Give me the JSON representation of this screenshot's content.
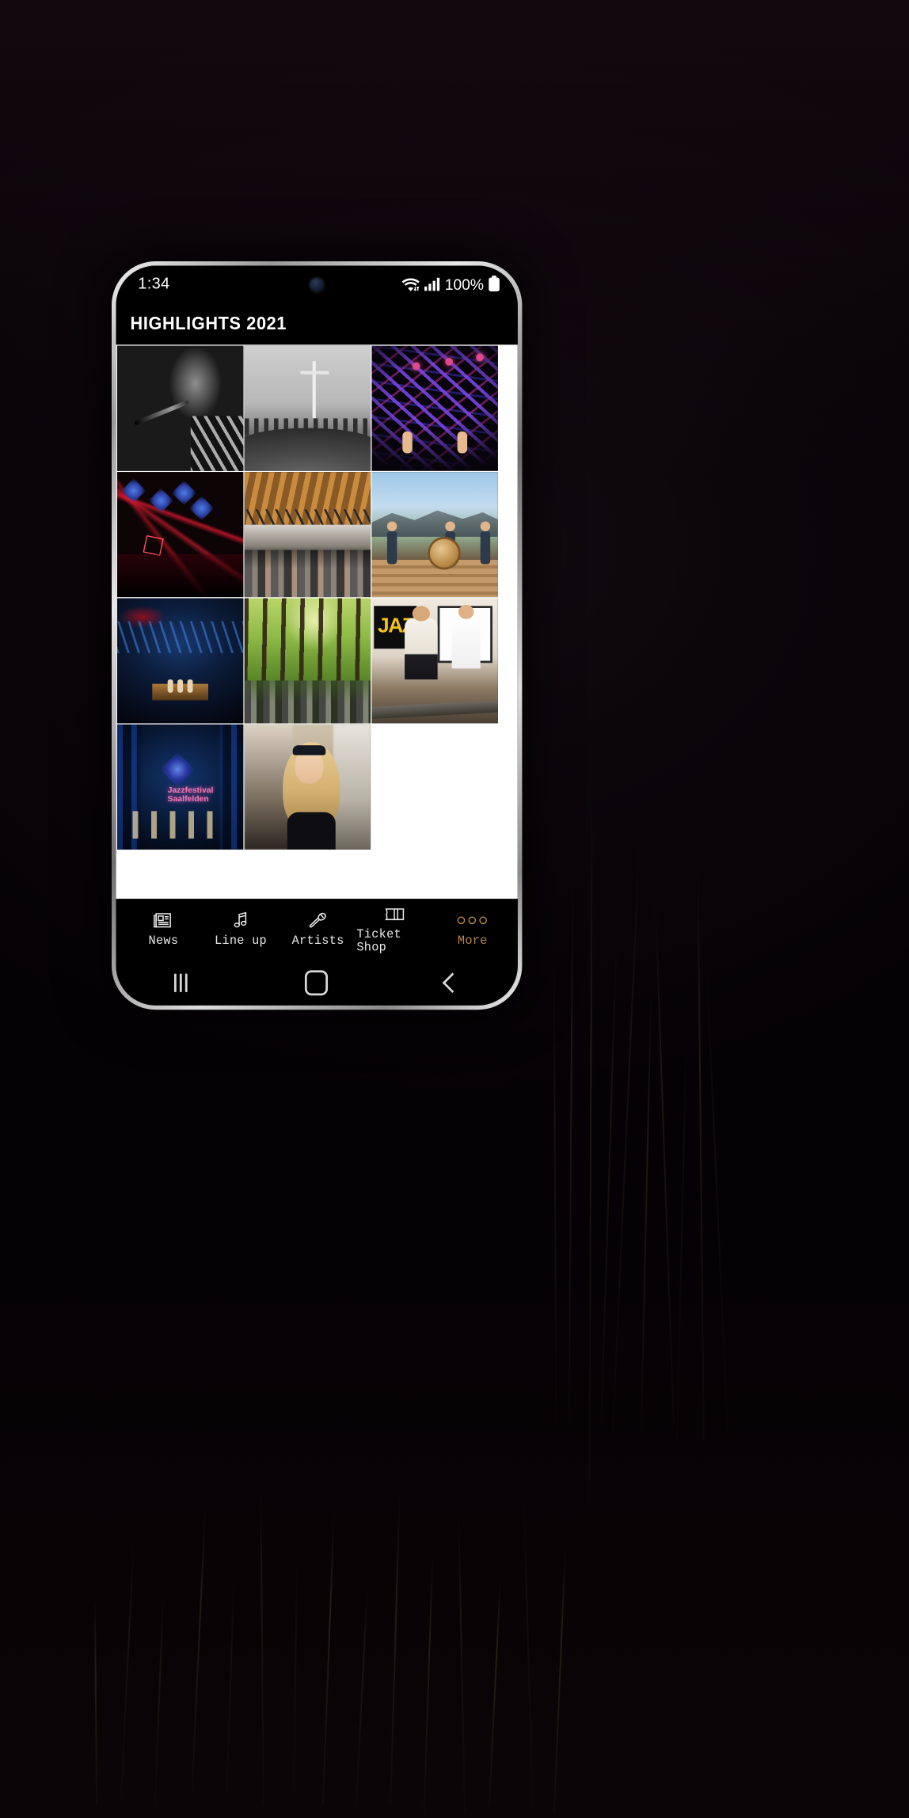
{
  "status_bar": {
    "time": "1:34",
    "battery_percent": "100%",
    "icons": [
      "wifi-icon",
      "signal-bars-icon",
      "battery-icon"
    ]
  },
  "app": {
    "header_title": "HIGHLIGHTS 2021"
  },
  "gallery": {
    "columns": 3,
    "items": [
      {
        "name": "photo-singer-bw",
        "caption": ""
      },
      {
        "name": "photo-summit-cross-crowd-bw",
        "caption": ""
      },
      {
        "name": "photo-purple-stage-lights",
        "caption": ""
      },
      {
        "name": "photo-red-beams-club",
        "caption": ""
      },
      {
        "name": "photo-wooden-hall-crowd",
        "caption": ""
      },
      {
        "name": "photo-mountain-deck-band",
        "caption": ""
      },
      {
        "name": "photo-blue-venue-stage",
        "caption": ""
      },
      {
        "name": "photo-forest-concert",
        "caption": ""
      },
      {
        "name": "photo-jazz-banner-people",
        "caption": "JAZ"
      },
      {
        "name": "photo-blue-stage-trio",
        "caption": "Jazzfestival Saalfelden"
      },
      {
        "name": "photo-woman-bandana-crowd",
        "caption": ""
      }
    ]
  },
  "tab_bar": {
    "active": "More",
    "active_color": "#b8864f",
    "items": [
      {
        "label": "News",
        "icon": "newspaper-icon"
      },
      {
        "label": "Line up",
        "icon": "music-note-icon"
      },
      {
        "label": "Artists",
        "icon": "microphone-icon"
      },
      {
        "label": "Ticket Shop",
        "icon": "ticket-icon"
      },
      {
        "label": "More",
        "icon": "three-dots-icon"
      }
    ]
  },
  "android_nav": {
    "recents": "recents-icon",
    "home": "home-icon",
    "back": "back-icon"
  }
}
